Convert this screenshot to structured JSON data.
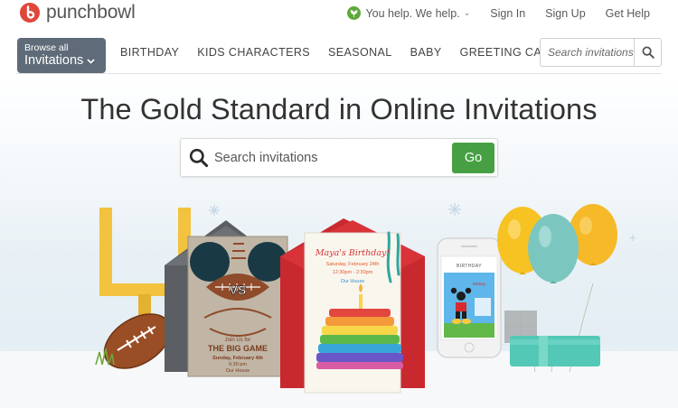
{
  "brand": {
    "name": "punchbowl",
    "accent": "#e0463a"
  },
  "topbar": {
    "help_label": "You help. We help.",
    "links": [
      "Sign In",
      "Sign Up",
      "Get Help"
    ]
  },
  "nav": {
    "browse_top": "Browse all",
    "browse_bottom": "Invitations",
    "categories": [
      "BIRTHDAY",
      "KIDS CHARACTERS",
      "SEASONAL",
      "BABY",
      "GREETING CARDS"
    ],
    "search_placeholder": "Search invitations"
  },
  "hero": {
    "headline": "The Gold Standard in Online Invitations",
    "search_placeholder": "Search invitations",
    "go_label": "Go",
    "go_color": "#46a043"
  },
  "cards": {
    "game": {
      "vs": "VS",
      "join": "Join Us for",
      "title": "THE BIG GAME",
      "date": "Sunday, February 4th",
      "time": "6:30 pm",
      "place": "Our House"
    },
    "birthday": {
      "title": "Maya's Birthday!",
      "date": "Saturday, February 24th",
      "time": "12:30pm - 2:30pm",
      "place": "Our House"
    },
    "phone": {
      "header": "BIRTHDAY"
    }
  },
  "icons": {
    "logo": "punchbowl-logo-icon",
    "help": "leaf-icon",
    "search": "search-icon",
    "chevron": "chevron-down-icon"
  }
}
